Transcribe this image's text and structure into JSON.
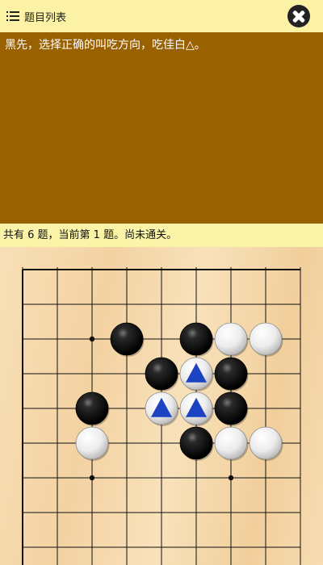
{
  "header": {
    "list_label": "题目列表",
    "list_icon": "list-icon",
    "close_icon": "close-icon"
  },
  "problem": {
    "prompt": "黑先，选择正确的叫吃方向，吃佳白△。"
  },
  "status": {
    "text": "共有 6 题，当前第 1 题。尚未通关。"
  },
  "colors": {
    "header_bg": "#fbf2a6",
    "prompt_bg": "#9a6101",
    "status_bg": "#fbf4a8",
    "board_bg": "#f6dcb2",
    "marker": "#1c43c2"
  },
  "board": {
    "visible_columns": 9,
    "visible_rows": 9,
    "star_points": [
      [
        2,
        2
      ],
      [
        6,
        2
      ],
      [
        2,
        6
      ],
      [
        6,
        6
      ]
    ],
    "stones": [
      {
        "color": "black",
        "col": 3,
        "row": 2
      },
      {
        "color": "black",
        "col": 5,
        "row": 2
      },
      {
        "color": "white",
        "col": 6,
        "row": 2
      },
      {
        "color": "white",
        "col": 7,
        "row": 2
      },
      {
        "color": "black",
        "col": 4,
        "row": 3
      },
      {
        "color": "white",
        "col": 5,
        "row": 3,
        "marker": "triangle"
      },
      {
        "color": "black",
        "col": 6,
        "row": 3
      },
      {
        "color": "black",
        "col": 2,
        "row": 4
      },
      {
        "color": "white",
        "col": 4,
        "row": 4,
        "marker": "triangle"
      },
      {
        "color": "white",
        "col": 5,
        "row": 4,
        "marker": "triangle"
      },
      {
        "color": "black",
        "col": 6,
        "row": 4
      },
      {
        "color": "white",
        "col": 2,
        "row": 5
      },
      {
        "color": "black",
        "col": 5,
        "row": 5
      },
      {
        "color": "white",
        "col": 6,
        "row": 5
      },
      {
        "color": "white",
        "col": 7,
        "row": 5
      }
    ]
  }
}
